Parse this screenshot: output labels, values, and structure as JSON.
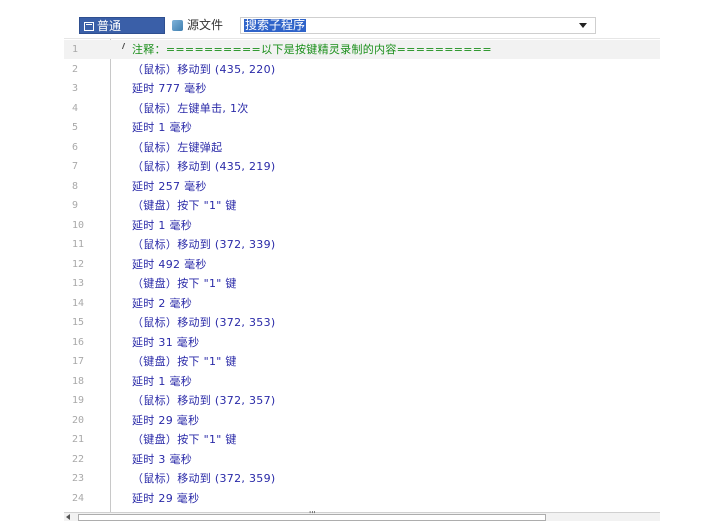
{
  "toolbar": {
    "tab_normal": "普通",
    "tab_source": "源文件",
    "search_value": "搜索子程序",
    "accent_color": "#3a5fa8"
  },
  "editor": {
    "lines": [
      {
        "n": "1",
        "text": "注释：==========以下是按键精灵录制的内容==========",
        "kind": "comment"
      },
      {
        "n": "2",
        "text": "（鼠标）移动到 (435, 220)",
        "kind": "code"
      },
      {
        "n": "3",
        "text": "延时 777 毫秒",
        "kind": "code"
      },
      {
        "n": "4",
        "text": "（鼠标）左键单击, 1次",
        "kind": "code"
      },
      {
        "n": "5",
        "text": "延时 1 毫秒",
        "kind": "code"
      },
      {
        "n": "6",
        "text": "（鼠标）左键弹起",
        "kind": "code"
      },
      {
        "n": "7",
        "text": "（鼠标）移动到 (435, 219)",
        "kind": "code"
      },
      {
        "n": "8",
        "text": "延时 257 毫秒",
        "kind": "code"
      },
      {
        "n": "9",
        "text": "（键盘）按下 \"1\" 键",
        "kind": "code"
      },
      {
        "n": "10",
        "text": "延时 1 毫秒",
        "kind": "code"
      },
      {
        "n": "11",
        "text": "（鼠标）移动到 (372, 339)",
        "kind": "code"
      },
      {
        "n": "12",
        "text": "延时 492 毫秒",
        "kind": "code"
      },
      {
        "n": "13",
        "text": "（键盘）按下 \"1\" 键",
        "kind": "code"
      },
      {
        "n": "14",
        "text": "延时 2 毫秒",
        "kind": "code"
      },
      {
        "n": "15",
        "text": "（鼠标）移动到 (372, 353)",
        "kind": "code"
      },
      {
        "n": "16",
        "text": "延时 31 毫秒",
        "kind": "code"
      },
      {
        "n": "17",
        "text": "（键盘）按下 \"1\" 键",
        "kind": "code"
      },
      {
        "n": "18",
        "text": "延时 1 毫秒",
        "kind": "code"
      },
      {
        "n": "19",
        "text": "（鼠标）移动到 (372, 357)",
        "kind": "code"
      },
      {
        "n": "20",
        "text": "延时 29 毫秒",
        "kind": "code"
      },
      {
        "n": "21",
        "text": "（键盘）按下 \"1\" 键",
        "kind": "code"
      },
      {
        "n": "22",
        "text": "延时 3 毫秒",
        "kind": "code"
      },
      {
        "n": "23",
        "text": "（鼠标）移动到 (372, 359)",
        "kind": "code"
      },
      {
        "n": "24",
        "text": "延时 29 毫秒",
        "kind": "code"
      }
    ],
    "comment_color": "#1a8f1a",
    "code_color": "#2a2aa8",
    "line_number_color": "#a9a9a9"
  },
  "scrollbar": {
    "grip": "'''"
  }
}
